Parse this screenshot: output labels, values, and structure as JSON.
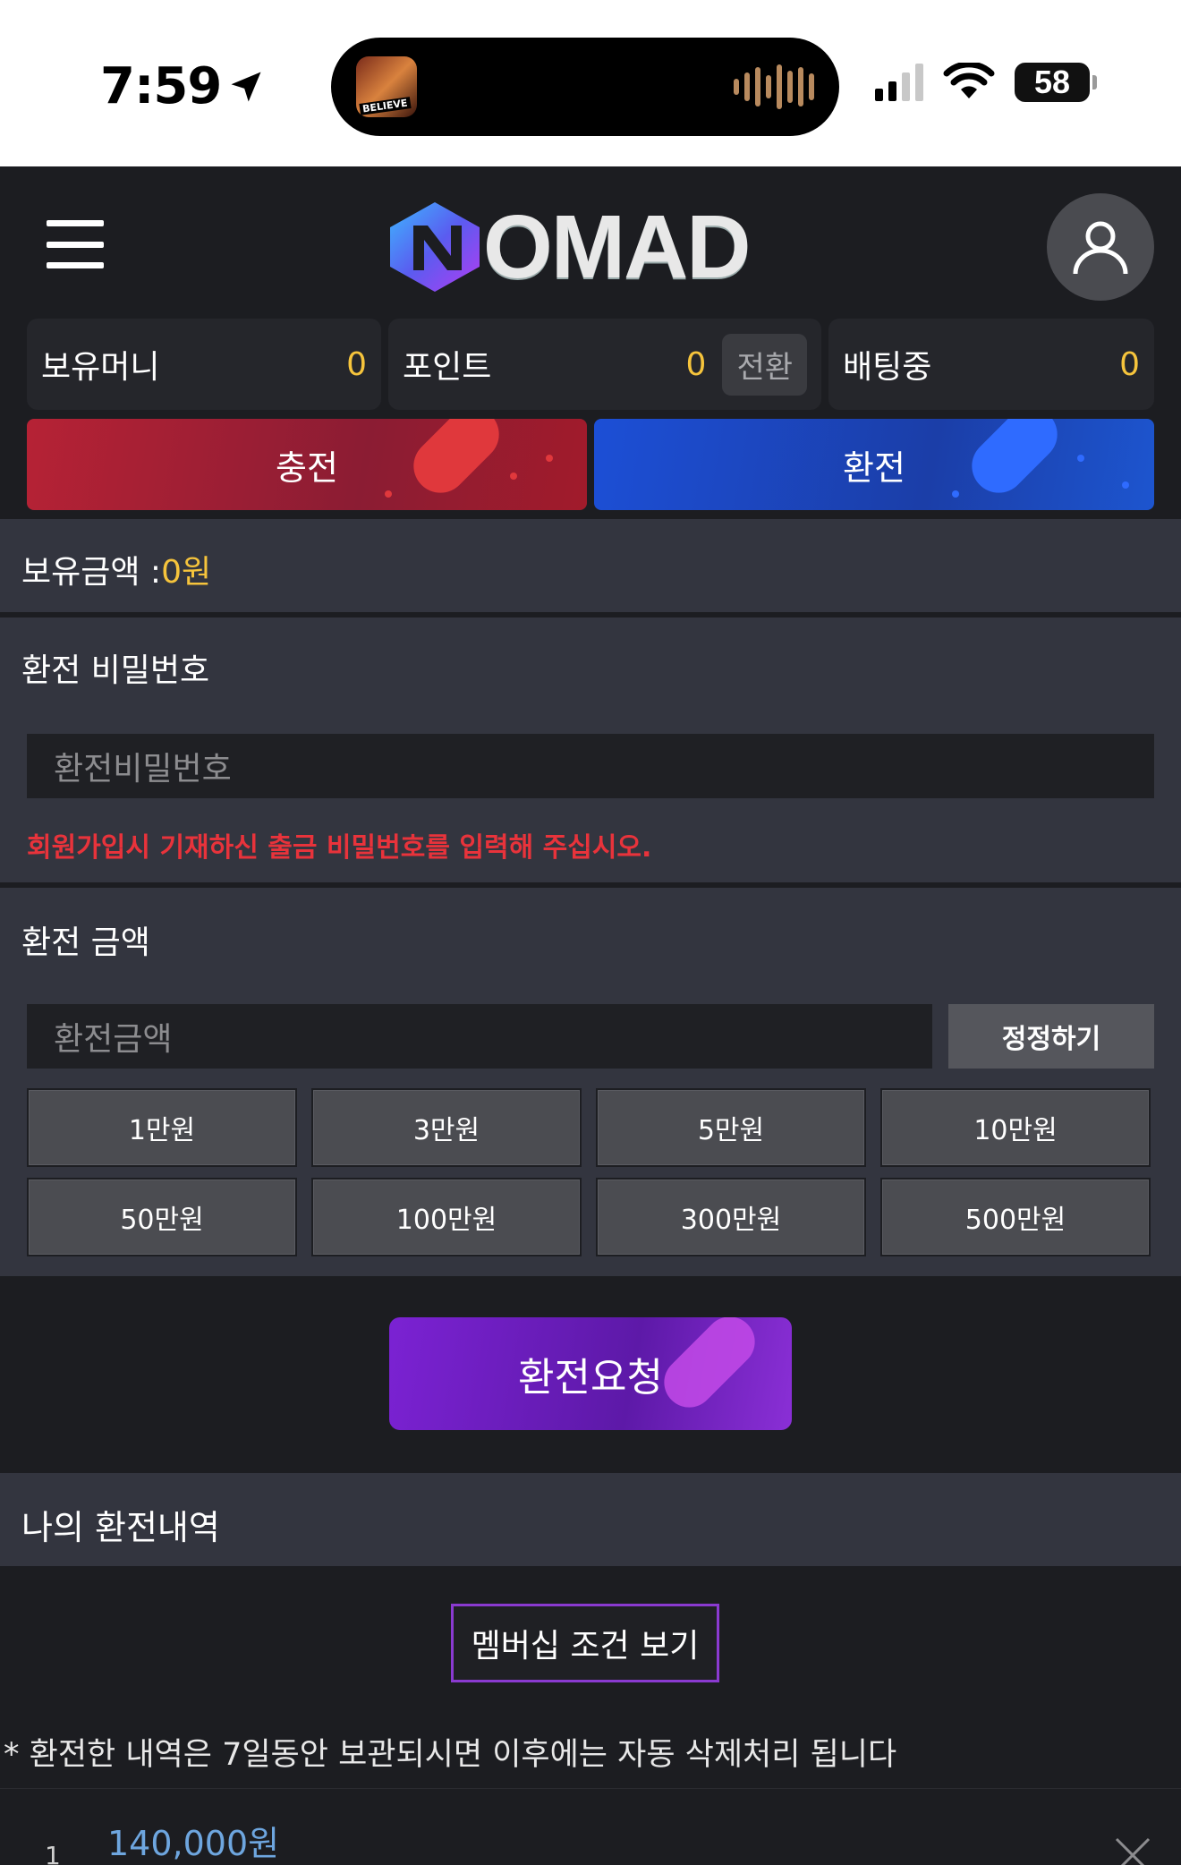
{
  "status_bar": {
    "time": "7:59",
    "battery": "58",
    "album_label": "BELIEVE"
  },
  "header": {
    "logo_text": "OMAD",
    "logo_brand": "NOMAD",
    "menu_icon": "hamburger-icon",
    "profile_icon": "user-icon"
  },
  "balances": [
    {
      "label": "보유머니",
      "value": "0"
    },
    {
      "label": "포인트",
      "value": "0",
      "action": "전환"
    },
    {
      "label": "배팅중",
      "value": "0"
    }
  ],
  "actions": {
    "charge": "충전",
    "withdraw": "환전"
  },
  "held_amount": {
    "label": "보유금액 :",
    "value": "0원"
  },
  "password_section": {
    "title": "환전 비밀번호",
    "placeholder": "환전비밀번호",
    "warning": "회원가입시 기재하신 출금 비밀번호를 입력해 주십시오."
  },
  "amount_section": {
    "title": "환전 금액",
    "placeholder": "환전금액",
    "fix_button": "정정하기",
    "quick_amounts": [
      "1만원",
      "3만원",
      "5만원",
      "10만원",
      "50만원",
      "100만원",
      "300만원",
      "500만원"
    ]
  },
  "request_button": "환전요청",
  "history": {
    "title": "나의 환전내역",
    "membership_button": "멤버십 조건 보기",
    "notice": "* 환전한 내역은 7일동안 보관되시면 이후에는 자동 삭제처리 됩니다",
    "rows": [
      {
        "index": "1",
        "amount": "140,000원"
      }
    ]
  },
  "colors": {
    "accent_yellow": "#f6c43c",
    "warning_red": "#e8333b",
    "charge_red": "#b62235",
    "withdraw_blue": "#1c4fd6",
    "request_purple": "#7b22d3",
    "history_amount_blue": "#6ea6df"
  }
}
